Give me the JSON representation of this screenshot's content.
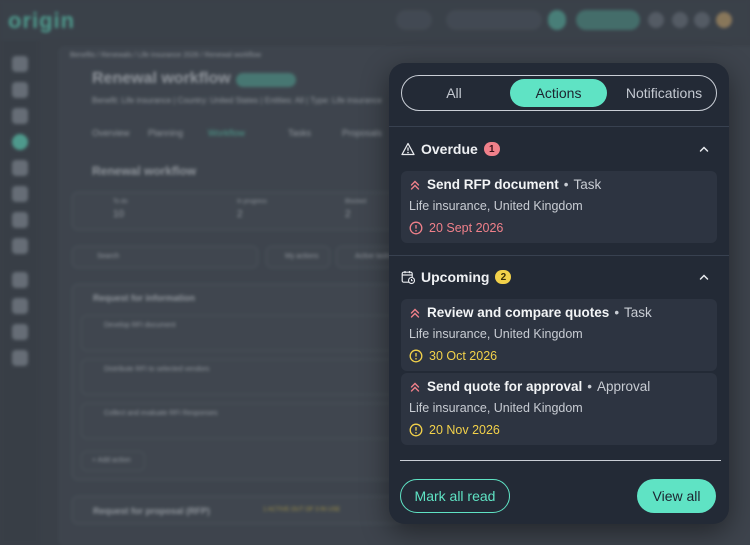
{
  "background": {
    "logo": "origin",
    "breadcrumb": "Benefits / Renewals / Life insurance 2026 / Renewal workflow",
    "page_title": "Renewal workflow",
    "status_chip": "In progress",
    "meta_line": "Benefit: Life insurance | Country: United States | Entities: All | Type: Life insurance",
    "tabs": [
      "Overview",
      "Planning",
      "Workflow",
      "Tasks",
      "Proposals"
    ],
    "section_title": "Renewal workflow",
    "stats": [
      {
        "label": "To do",
        "value": "10"
      },
      {
        "label": "In progress",
        "value": "2"
      },
      {
        "label": "Blocked",
        "value": "2"
      }
    ],
    "search_placeholder": "Search",
    "filter_my_actions": "My actions",
    "filter_active": "Active tasks",
    "groups": [
      {
        "title": "Request for information",
        "items": [
          "Develop RFI document",
          "Distribute RFI to selected vendors",
          "Collect and evaluate RFI Responses"
        ]
      },
      {
        "title": "Request for proposal (RFP)",
        "items": []
      }
    ],
    "add_action": "+ Add action",
    "bottom_chip": "1 ACTIVE OUT OF 3 IN USE"
  },
  "panel": {
    "tabs": [
      {
        "label": "All",
        "active": false
      },
      {
        "label": "Actions",
        "active": true
      },
      {
        "label": "Notifications",
        "active": false
      }
    ],
    "sections": [
      {
        "title": "Overdue",
        "count": "1",
        "icon": "warning-triangle-icon",
        "items": [
          {
            "title": "Send RFP document",
            "kind": "Task",
            "subtitle": "Life insurance, United Kingdom",
            "date": "20 Sept 2026",
            "date_status": "overdue"
          }
        ]
      },
      {
        "title": "Upcoming",
        "count": "2",
        "icon": "calendar-clock-icon",
        "items": [
          {
            "title": "Review and compare quotes",
            "kind": "Task",
            "subtitle": "Life insurance, United Kingdom",
            "date": "30 Oct 2026",
            "date_status": "upcoming"
          },
          {
            "title": "Send quote for approval",
            "kind": "Approval",
            "subtitle": "Life insurance, United Kingdom",
            "date": "20 Nov 2026",
            "date_status": "upcoming"
          }
        ]
      }
    ],
    "mark_all_read": "Mark all read",
    "view_all": "View all",
    "colors": {
      "accent": "#5fe3c4",
      "overdue": "#f0808a",
      "upcoming": "#f2d14a",
      "panel_bg": "#232a36",
      "card_bg": "#2d3441"
    }
  }
}
